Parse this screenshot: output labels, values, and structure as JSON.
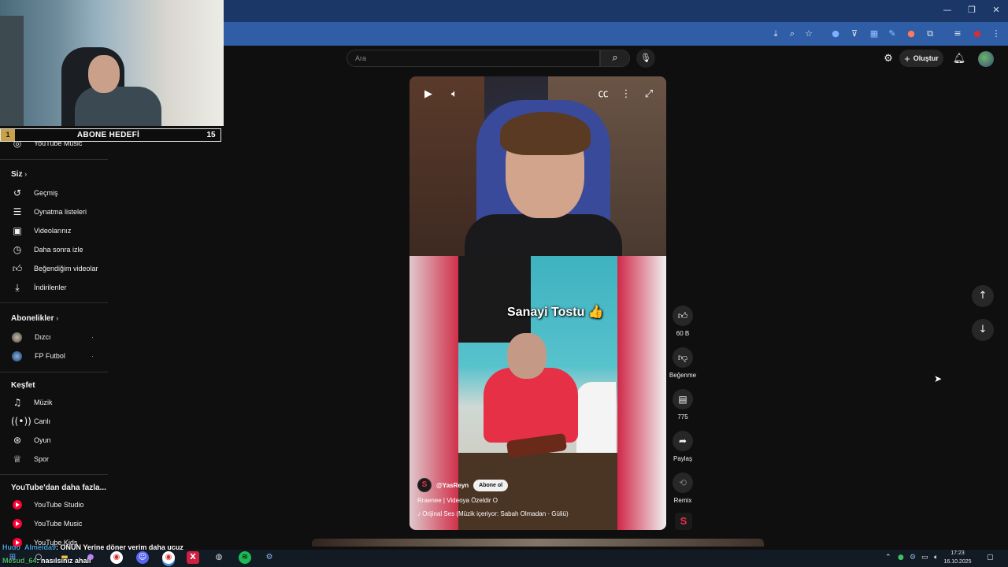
{
  "browser": {
    "window_controls": [
      "—",
      "❐",
      "✕"
    ],
    "toolbar_icons": [
      "install-icon",
      "zoom-icon",
      "star-icon",
      "ext-1-icon",
      "ext-2-icon",
      "ext-3-icon",
      "ext-4-icon",
      "ext-5-icon",
      "puzzle-icon",
      "media-icon",
      "profile-icon",
      "menu-icon"
    ]
  },
  "stream_overlay": {
    "goal_number": "1",
    "goal_title": "ABONE HEDEFİ",
    "goal_count": "15",
    "chat": [
      {
        "user": "Hugo_Almeida9",
        "message": ": ONUN Yerine döner yerim daha ucuz"
      },
      {
        "user": "Mesud_64",
        "message": ": nasılsınız ahali"
      }
    ]
  },
  "sidebar": {
    "top_item": "YouTube Music",
    "you_header": "Siz",
    "you_items": [
      {
        "label": "Geçmiş",
        "icon": "history-icon"
      },
      {
        "label": "Oynatma listeleri",
        "icon": "playlist-icon"
      },
      {
        "label": "Videolarınız",
        "icon": "your-videos-icon"
      },
      {
        "label": "Daha sonra izle",
        "icon": "watch-later-icon"
      },
      {
        "label": "Beğendiğim videolar",
        "icon": "liked-icon"
      },
      {
        "label": "İndirilenler",
        "icon": "download-icon"
      }
    ],
    "subs_header": "Abonelikler",
    "subscriptions": [
      {
        "label": "Dızcı"
      },
      {
        "label": "FP Futbol"
      }
    ],
    "explore_header": "Keşfet",
    "explore_items": [
      {
        "label": "Müzik",
        "icon": "music-icon"
      },
      {
        "label": "Canlı",
        "icon": "live-icon"
      },
      {
        "label": "Oyun",
        "icon": "gaming-icon"
      },
      {
        "label": "Spor",
        "icon": "trophy-icon"
      }
    ],
    "more_header": "YouTube'dan daha fazla...",
    "more_items": [
      {
        "label": "YouTube Studio"
      },
      {
        "label": "YouTube Music"
      },
      {
        "label": "YouTube Kids"
      }
    ]
  },
  "header": {
    "search_placeholder": "Ara",
    "create_label": "Oluştur"
  },
  "short": {
    "caption": "Sanayi Tostu 👍",
    "channel_initial": "S",
    "channel_handle": "@YasReyn",
    "subscribe_label": "Abone ol",
    "title": "Rraenee | Videoya Özeldir O",
    "audio": "♪ Orijinal Ses (Müzik içeriyor: Sabah Olmadan · Güliü)"
  },
  "actions": {
    "likes": "60 B",
    "dislike_label": "Beğenme",
    "comments": "775",
    "share_label": "Paylaş",
    "remix_label": "Remix"
  },
  "taskbar": {
    "time": "17:23",
    "date": "16.10.2025"
  }
}
